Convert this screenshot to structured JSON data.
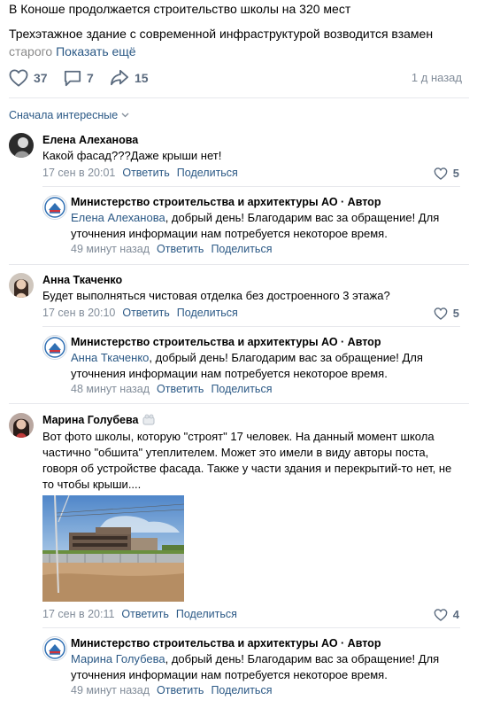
{
  "post": {
    "title": "В Коноше продолжается строительство школы на 320 мест",
    "body_visible": "Трехэтажное здание с современной инфраструктурой возводится взамен",
    "body_fade": "старого",
    "show_more": "Показать ещё",
    "likes": "37",
    "comments": "7",
    "shares": "15",
    "time": "1 д назад"
  },
  "sort": {
    "label": "Сначала интересные"
  },
  "actions": {
    "reply": "Ответить",
    "share": "Поделиться"
  },
  "comments": [
    {
      "author": "Елена Алеханова",
      "text": "Какой фасад???Даже крыши нет!",
      "date": "17 сен в 20:01",
      "likes": "5",
      "reply": {
        "author": "Министерство строительства и архитектуры АО · Автор",
        "mention": "Елена Алеханова",
        "text_line1": ", добрый день! Благодарим вас за обращение! Для",
        "text_line2": "уточнения информации нам потребуется некоторое время.",
        "date": "49 минут назад"
      }
    },
    {
      "author": "Анна Ткаченко",
      "text": "Будет выполняться чистовая отделка без достроенного 3 этажа?",
      "date": "17 сен в 20:10",
      "likes": "5",
      "reply": {
        "author": "Министерство строительства и архитектуры АО · Автор",
        "mention": "Анна Ткаченко",
        "text_line1": ", добрый день! Благодарим вас за обращение! Для",
        "text_line2": "уточнения информации нам потребуется некоторое время.",
        "date": "48 минут назад"
      }
    },
    {
      "author": "Марина Голубева",
      "text_line1": "Вот фото школы, которую \"строят\" 17 человек. На данный момент школа",
      "text_line2": "частично \"обшита\" утеплителем. Может это имели в виду авторы поста,",
      "text_line3": "говоря об устройстве фасада. Также у части здания и перекрытий-то нет, не",
      "text_line4": "то чтобы крыши....",
      "date": "17 сен в 20:11",
      "likes": "4",
      "reply": {
        "author": "Министерство строительства и архитектуры АО · Автор",
        "mention": "Марина Голубева",
        "text_line1": ", добрый день! Благодарим вас за обращение! Для",
        "text_line2": "уточнения информации нам потребуется некоторое время.",
        "date": "49 минут назад"
      }
    }
  ],
  "colors": {
    "link": "#2a5885",
    "meta": "#818c99",
    "icon": "#5b6b7f",
    "divider": "#e7e8ec"
  }
}
